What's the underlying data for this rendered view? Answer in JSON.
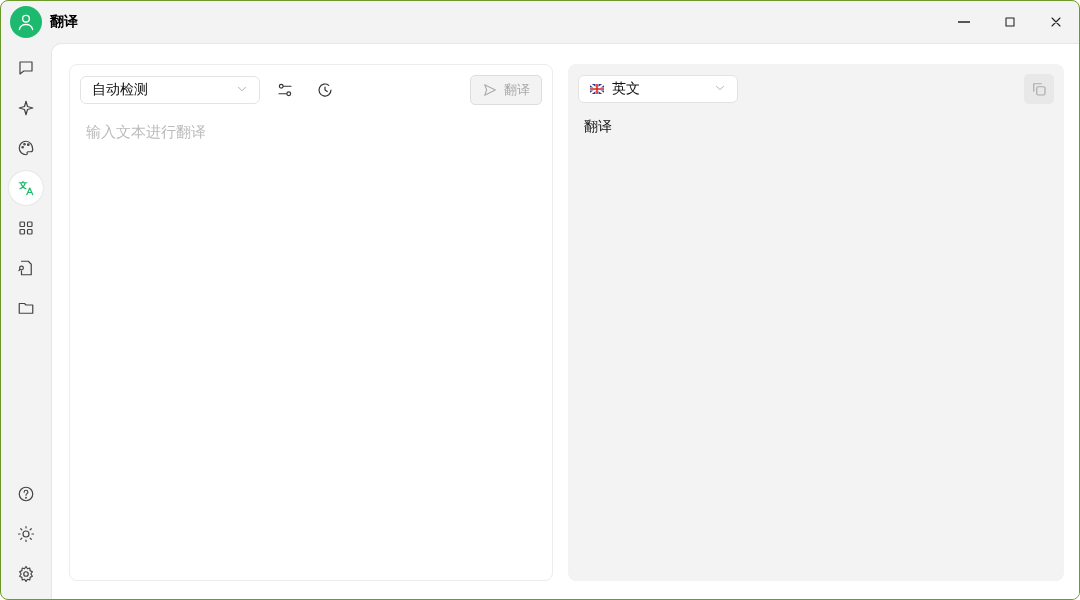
{
  "window": {
    "title": "翻译"
  },
  "sidebar": {
    "top_items": [
      {
        "selected": false
      },
      {
        "selected": false
      },
      {
        "selected": false
      },
      {
        "selected": true
      },
      {
        "selected": false
      },
      {
        "selected": false
      },
      {
        "selected": false
      }
    ],
    "bottom_items": [
      {
        "selected": false
      },
      {
        "selected": false
      },
      {
        "selected": false
      }
    ]
  },
  "source": {
    "language": "自动检测",
    "placeholder": "输入文本进行翻译",
    "translate_button": {
      "label": "翻译",
      "disabled": true
    }
  },
  "target": {
    "language": "英文",
    "output": "翻译",
    "copy_button": {
      "disabled": true
    }
  }
}
